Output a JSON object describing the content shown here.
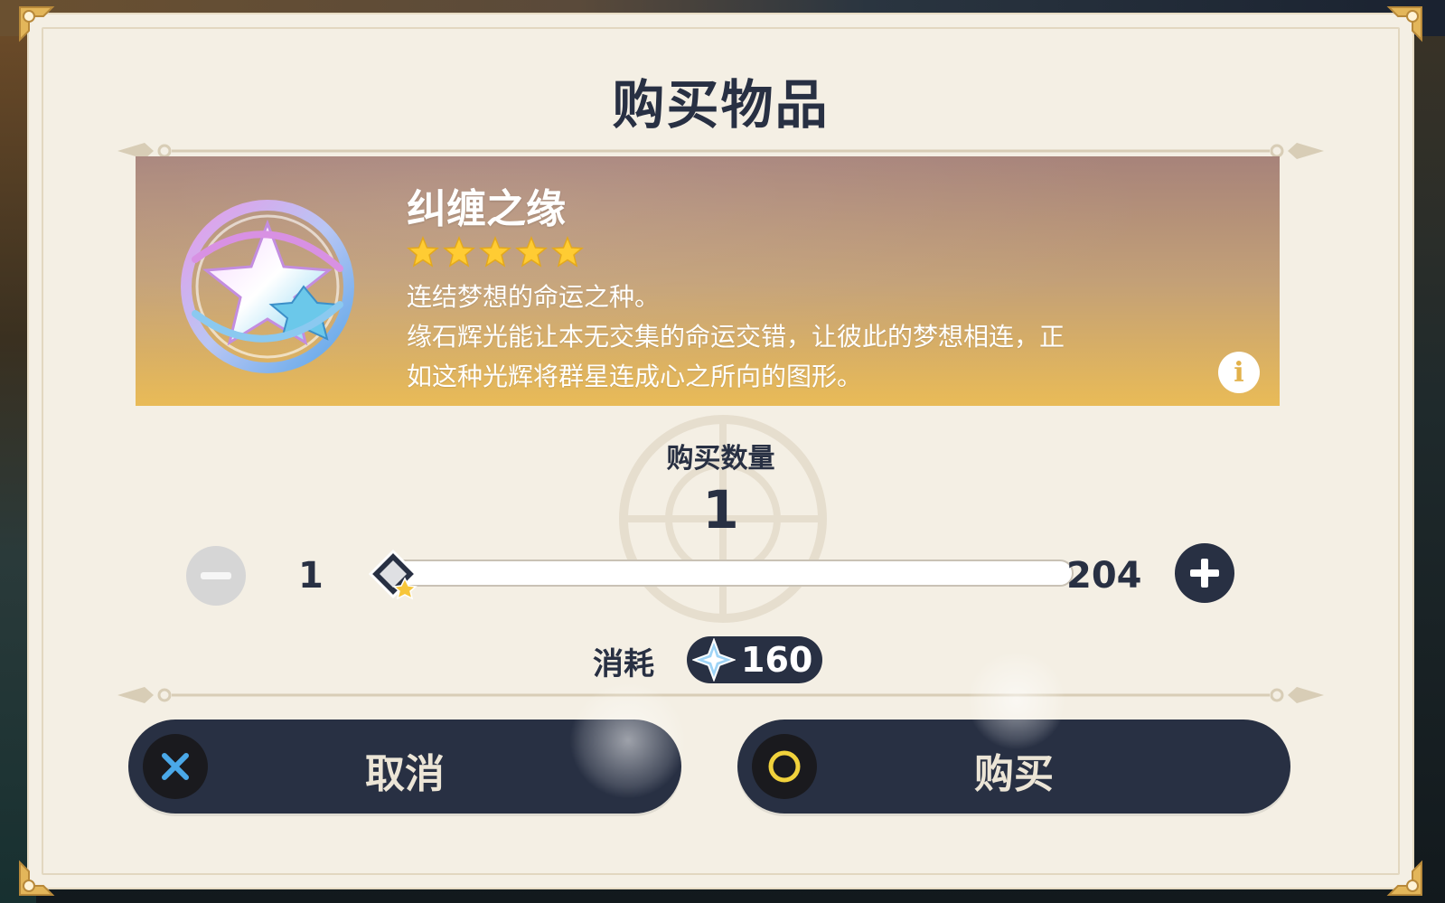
{
  "dialog": {
    "title": "购买物品"
  },
  "item": {
    "name": "纠缠之缘",
    "rarity_stars": 5,
    "description_line1": "连结梦想的命运之种。",
    "description_line2": "缘石辉光能让本无交集的命运交错，让彼此的梦想相连，正",
    "description_line3": "如这种光辉将群星连成心之所向的图形。",
    "icon": "intertwined-fate-icon",
    "info_icon": "info-icon"
  },
  "quantity": {
    "label": "购买数量",
    "value": "1",
    "min": "1",
    "max": "204",
    "fraction": 0
  },
  "cost": {
    "label": "消耗",
    "value": "160",
    "icon": "primogem-icon"
  },
  "buttons": {
    "cancel_label": "取消",
    "cancel_key_icon": "cross-key-icon",
    "buy_label": "购买",
    "buy_key_icon": "circle-key-icon"
  },
  "colors": {
    "panel": "#f4efe4",
    "navy": "#283043",
    "gold": "#e9bb57"
  }
}
